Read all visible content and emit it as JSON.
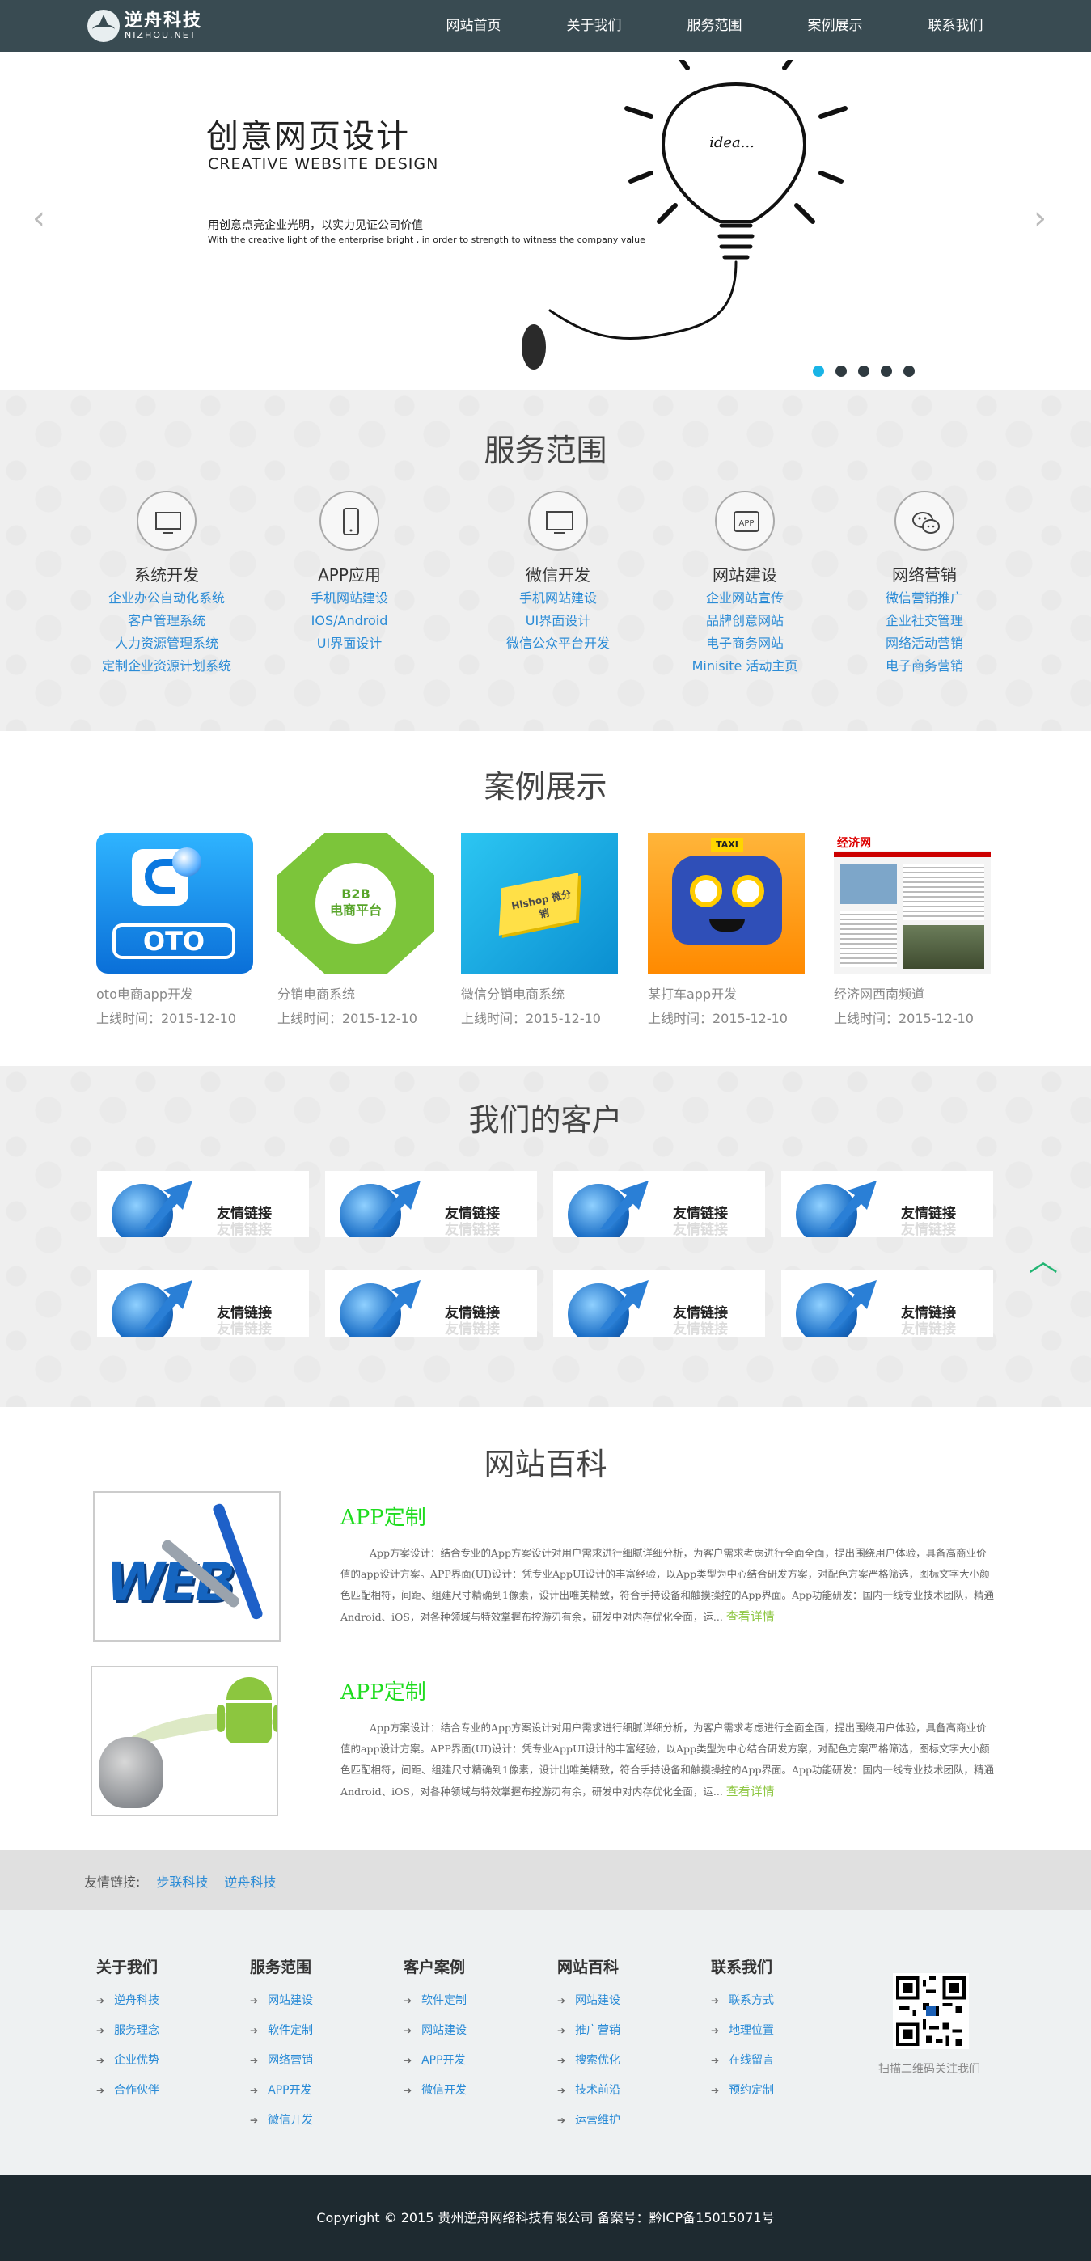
{
  "header": {
    "logo_cn": "逆舟科技",
    "logo_en": "NIZHOU.NET",
    "nav": [
      "网站首页",
      "关于我们",
      "服务范围",
      "案例展示",
      "联系我们"
    ]
  },
  "banner": {
    "title": "创意网页设计",
    "subtitle": "CREATIVE WEBSITE DESIGN",
    "line1": "用创意点亮企业光明，以实力见证公司价值",
    "line2": "With the creative light of the enterprise bright , in order to strength to witness the company value",
    "bulb_text": "idea...",
    "prev": "‹",
    "next": "›",
    "slide_count": 5,
    "active_slide": 1
  },
  "services": {
    "title": "服务范围",
    "items": [
      {
        "name": "系统开发",
        "icon": "monitor-icon",
        "list": [
          "企业办公自动化系统",
          "客户管理系统",
          "人力资源管理系统",
          "定制企业资源计划系统"
        ]
      },
      {
        "name": "APP应用",
        "icon": "phone-icon",
        "list": [
          "手机网站建设",
          "IOS/Android",
          "UI界面设计"
        ]
      },
      {
        "name": "微信开发",
        "icon": "screen-icon",
        "list": [
          "手机网站建设",
          "UI界面设计",
          "微信公众平台开发"
        ]
      },
      {
        "name": "网站建设",
        "icon": "app-icon",
        "list": [
          "企业网站宣传",
          "品牌创意网站",
          "电子商务网站",
          "Minisite 活动主页"
        ]
      },
      {
        "name": "网络营销",
        "icon": "wechat-icon",
        "list": [
          "微信营销推广",
          "企业社交管理",
          "网络活动营销",
          "电子商务营销"
        ]
      }
    ]
  },
  "cases": {
    "title": "案例展示",
    "items": [
      {
        "name": "oto电商app开发",
        "date": "上线时间：2015-12-10",
        "img_text": "OTO"
      },
      {
        "name": "分销电商系统",
        "date": "上线时间：2015-12-10",
        "img_text": "B2B\n电商平台"
      },
      {
        "name": "微信分销电商系统",
        "date": "上线时间：2015-12-10",
        "img_text": "Hishop 微分销"
      },
      {
        "name": "某打车app开发",
        "date": "上线时间：2015-12-10",
        "img_text": "TAXI"
      },
      {
        "name": "经济网西南频道",
        "date": "上线时间：2015-12-10",
        "img_text": "经济网"
      }
    ]
  },
  "clients": {
    "title": "我们的客户",
    "label": "友情链接",
    "count": 8
  },
  "wiki": {
    "title": "网站百科",
    "items": [
      {
        "title": "APP定制",
        "img_text": "WEB",
        "text": "App方案设计：结合专业的App方案设计对用户需求进行细腻详细分析，为客户需求考虑进行全面全面，提出围绕用户体验，具备高商业价值的app设计方案。APP界面(UI)设计：凭专业AppUI设计的丰富经验，以App类型为中心结合研发方案，对配色方案严格筛选，图标文字大小颜色匹配相符，间距、组建尺寸精确到1像素，设计出唯美精致，符合手持设备和触摸操控的App界面。App功能研发：国内一线专业技术团队，精通Android、iOS，对各种领域与特效掌握布控游刃有余，研发中对内存优化全面，运...",
        "more": "查看详情"
      },
      {
        "title": "APP定制",
        "img_text": "apple-android",
        "text": "App方案设计：结合专业的App方案设计对用户需求进行细腻详细分析，为客户需求考虑进行全面全面，提出围绕用户体验，具备高商业价值的app设计方案。APP界面(UI)设计：凭专业AppUI设计的丰富经验，以App类型为中心结合研发方案，对配色方案严格筛选，图标文字大小颜色匹配相符，间距、组建尺寸精确到1像素，设计出唯美精致，符合手持设备和触摸操控的App界面。App功能研发：国内一线专业技术团队，精通Android、iOS，对各种领域与特效掌握布控游刃有余，研发中对内存优化全面，运...",
        "more": "查看详情"
      }
    ]
  },
  "links": {
    "label": "友情链接:",
    "items": [
      "步联科技",
      "逆舟科技"
    ]
  },
  "footer": {
    "cols": [
      {
        "title": "关于我们",
        "items": [
          "逆舟科技",
          "服务理念",
          "企业优势",
          "合作伙伴"
        ]
      },
      {
        "title": "服务范围",
        "items": [
          "网站建设",
          "软件定制",
          "网络营销",
          "APP开发",
          "微信开发"
        ]
      },
      {
        "title": "客户案例",
        "items": [
          "软件定制",
          "网站建设",
          "APP开发",
          "微信开发"
        ]
      },
      {
        "title": "网站百科",
        "items": [
          "网站建设",
          "推广营销",
          "搜索优化",
          "技术前沿",
          "运营维护"
        ]
      },
      {
        "title": "联系我们",
        "items": [
          "联系方式",
          "地理位置",
          "在线留言",
          "预约定制"
        ]
      }
    ],
    "qr_caption": "扫描二维码关注我们"
  },
  "copyright": "Copyright © 2015 贵州逆舟网络科技有限公司    备案号：黔ICP备15015071号",
  "colors": {
    "header": "#394b52",
    "link": "#2a8bd6",
    "wiki_title": "#1fdc1f",
    "more": "#8cc63f",
    "footer_dark": "#1e2a30",
    "dot_active": "#19b4e6"
  }
}
